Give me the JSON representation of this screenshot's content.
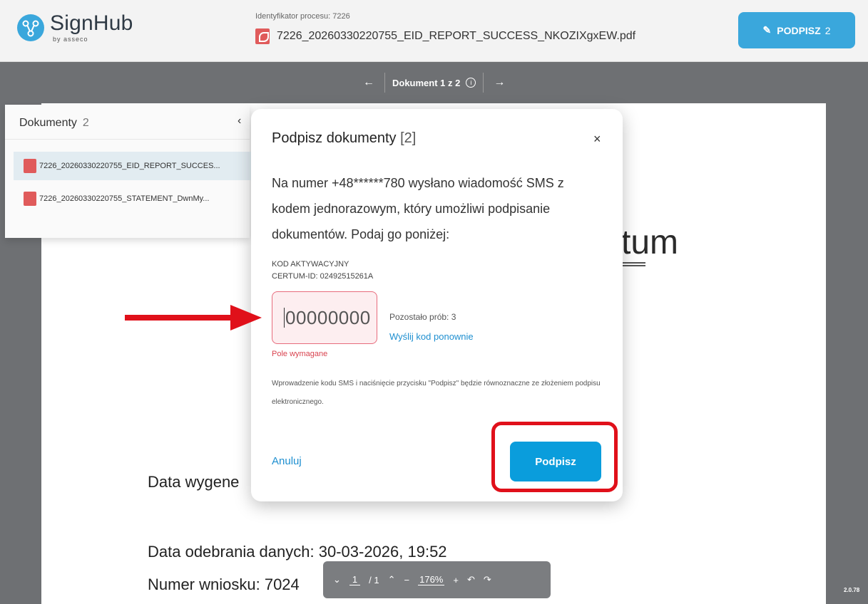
{
  "header": {
    "brand": "SignHub",
    "brand_by": "by asseco",
    "process_label": "Identyfikator procesu:  7226",
    "file_name": "7226_20260330220755_EID_REPORT_SUCCESS_NKOZIXgxEW.pdf",
    "sign_button_label": "PODPISZ",
    "sign_button_count": "2"
  },
  "doc_nav": {
    "prev_icon": "←",
    "title": "Dokument 1 z 2",
    "info_icon": "i",
    "next_icon": "→"
  },
  "sidebar": {
    "title": "Dokumenty",
    "count": "2",
    "collapse_icon": "‹",
    "items": [
      {
        "label": "7226_20260330220755_EID_REPORT_SUCCES..."
      },
      {
        "label": "7226_20260330220755_STATEMENT_DwnMy..."
      }
    ]
  },
  "document": {
    "logo_partial": "rtum",
    "line1": "Data wygene",
    "line2": "Data odebrania danych: 30-03-2026, 19:52",
    "line3": "Numer wniosku: 7024"
  },
  "modal": {
    "title": "Podpisz dokumenty",
    "title_count": "[2]",
    "close_icon": "×",
    "message": "Na numer +48******780 wysłano wiadomość SMS z kodem jednorazowym, który umożliwi podpisanie dokumentów. Podaj go poniżej:",
    "code_label": "KOD AKTYWACYJNY",
    "certum_id": "CERTUM-ID: 02492515261A",
    "code_placeholder": "00000000",
    "attempts": "Pozostało prób: 3",
    "resend": "Wyślij kod ponownie",
    "required": "Pole wymagane",
    "note": "Wprowadzenie kodu SMS i naciśnięcie przycisku \"Podpisz\" będzie równoznaczne ze złożeniem podpisu elektronicznego.",
    "cancel": "Anuluj",
    "submit": "Podpisz"
  },
  "toolbar": {
    "down_icon": "⌄",
    "page": "1",
    "page_total": "/ 1",
    "up_icon": "⌃",
    "zoom_out_icon": "−",
    "zoom": "176%",
    "zoom_in_icon": "+",
    "rotate_left_icon": "↶",
    "rotate_right_icon": "↷"
  },
  "version": "2.0.78",
  "colors": {
    "accent": "#3aa7dc",
    "button": "#0a9ddc",
    "error": "#d9434f",
    "highlight": "#e0101a"
  }
}
